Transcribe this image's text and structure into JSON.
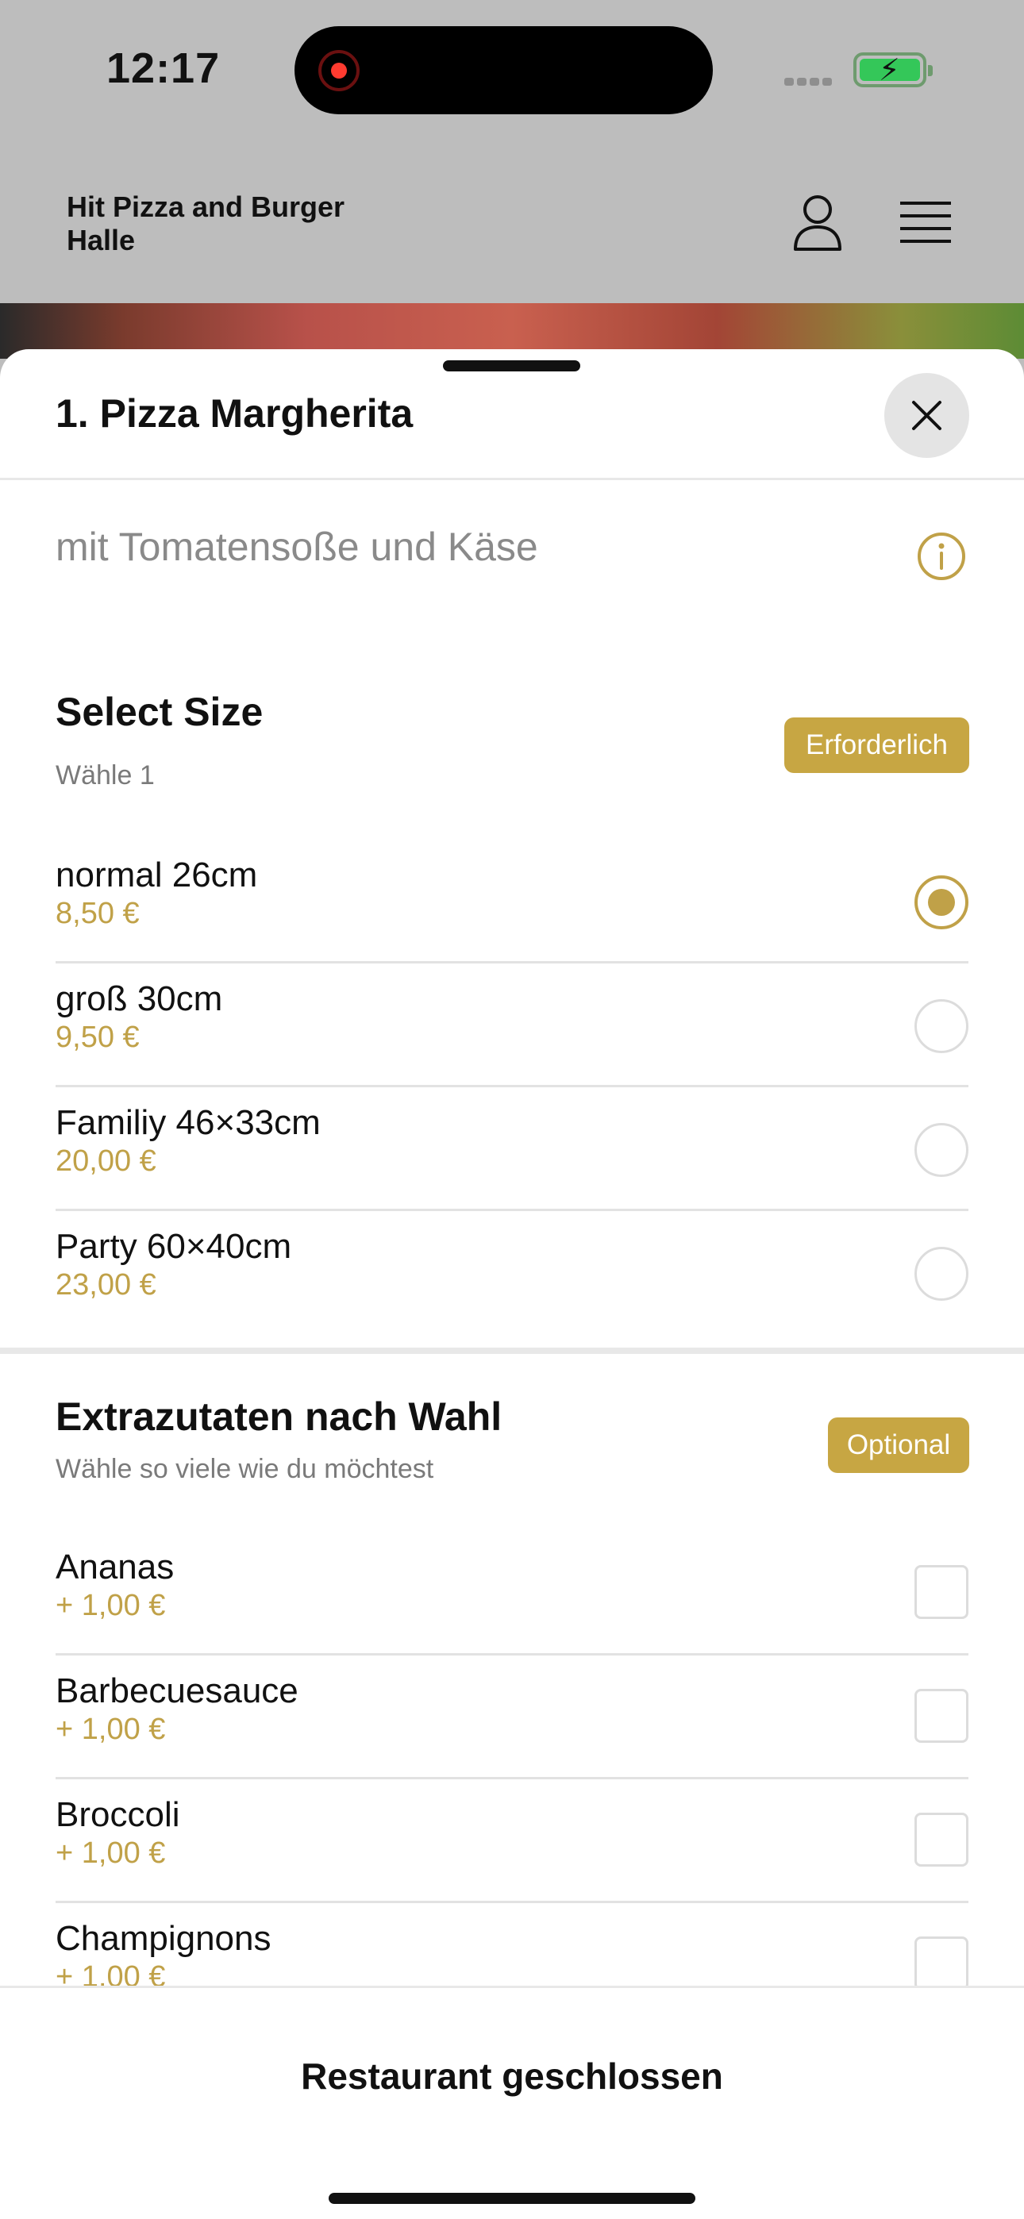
{
  "status_bar": {
    "time": "12:17"
  },
  "app_header": {
    "restaurant_name": "Hit Pizza and Burger Halle"
  },
  "sheet": {
    "title": "1. Pizza Margherita",
    "description": "mit Tomatensoße und Käse"
  },
  "size_section": {
    "title": "Select Size",
    "subtitle": "Wähle 1",
    "badge": "Erforderlich",
    "options": [
      {
        "name": "normal 26cm",
        "price": "8,50 €",
        "selected": true
      },
      {
        "name": "groß 30cm",
        "price": "9,50 €",
        "selected": false
      },
      {
        "name": "Familiy 46×33cm",
        "price": "20,00 €",
        "selected": false
      },
      {
        "name": "Party 60×40cm",
        "price": "23,00 €",
        "selected": false
      }
    ]
  },
  "extras_section": {
    "title": "Extrazutaten nach Wahl",
    "subtitle": "Wähle so viele wie du möchtest",
    "badge": "Optional",
    "options": [
      {
        "name": "Ananas",
        "price": "+ 1,00 €",
        "checked": false
      },
      {
        "name": "Barbecuesauce",
        "price": "+ 1,00 €",
        "checked": false
      },
      {
        "name": "Broccoli",
        "price": "+ 1,00 €",
        "checked": false
      },
      {
        "name": "Champignons",
        "price": "+ 1,00 €",
        "checked": false
      }
    ]
  },
  "footer": {
    "status_text": "Restaurant geschlossen"
  },
  "colors": {
    "accent": "#c0a148",
    "badge": "#c7a643",
    "dim_overlay": "#bdbdbd"
  },
  "icons": [
    "user-icon",
    "menu-icon",
    "close-icon",
    "info-icon"
  ]
}
